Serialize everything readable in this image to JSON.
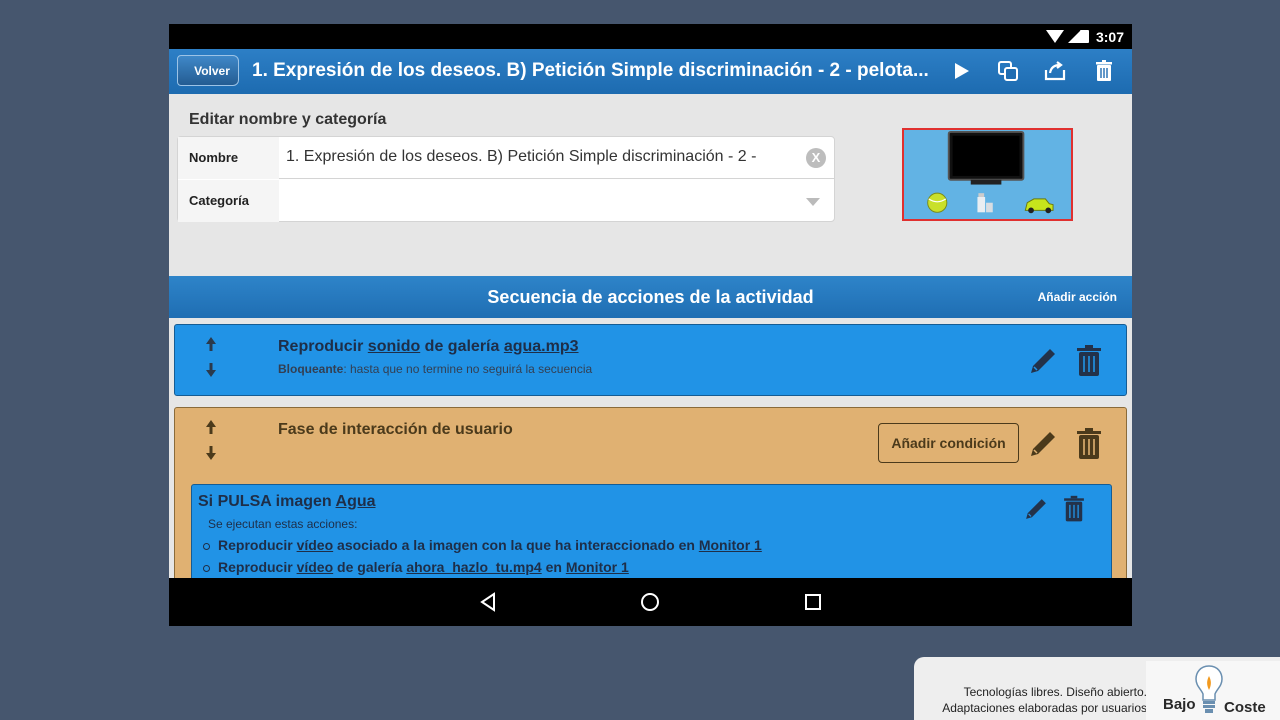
{
  "statusbar": {
    "time": "3:07"
  },
  "appbar": {
    "back_label": "Volver",
    "title": "1. Expresión de los deseos. B) Petición Simple discriminación - 2 - pelota...",
    "icons": [
      "play-icon",
      "copy-icon",
      "share-icon",
      "trash-icon"
    ]
  },
  "edit": {
    "heading": "Editar nombre y categoría",
    "name_label": "Nombre",
    "name_value": "1. Expresión de los deseos.  B) Petición Simple discriminación - 2 -",
    "clear_glyph": "X",
    "category_label": "Categoría",
    "category_value": ""
  },
  "sequence": {
    "title": "Secuencia de acciones de la actividad",
    "add_label": "Añadir acción"
  },
  "action1": {
    "title_prefix": "Reproducir ",
    "title_link1": "sonido",
    "title_mid": " de galería ",
    "title_link2": "agua.mp3",
    "sub_bold": "Bloqueante",
    "sub_rest": ": hasta que no termine no seguirá la secuencia"
  },
  "phase": {
    "title": "Fase de interacción de usuario",
    "condition_label": "Añadir condición"
  },
  "rule": {
    "title_prefix": "Si PULSA imagen ",
    "title_link": "Agua",
    "subtitle": "Se ejecutan estas acciones:",
    "line1": {
      "a": "Reproducir ",
      "l1": "vídeo",
      "b": " asociado a la imagen con la que ha interaccionado en ",
      "l2": "Monitor 1"
    },
    "line2": {
      "a": "Reproducir ",
      "l1": "vídeo",
      "b": " de galería ",
      "l2": "ahora_hazlo_tu.mp4",
      "c": " en ",
      "l3": "Monitor 1"
    }
  },
  "footer": {
    "line1": "Tecnologías libres. Diseño abierto.",
    "line2": "Adaptaciones elaboradas por usuarios",
    "logo_word1": "Bajo",
    "logo_word2": "Coste"
  },
  "colors": {
    "appbar_blue": "#1d6bb0",
    "action_blue": "#2193e6",
    "phase_tan": "#e0b172",
    "thumb_border": "#e0302f"
  }
}
